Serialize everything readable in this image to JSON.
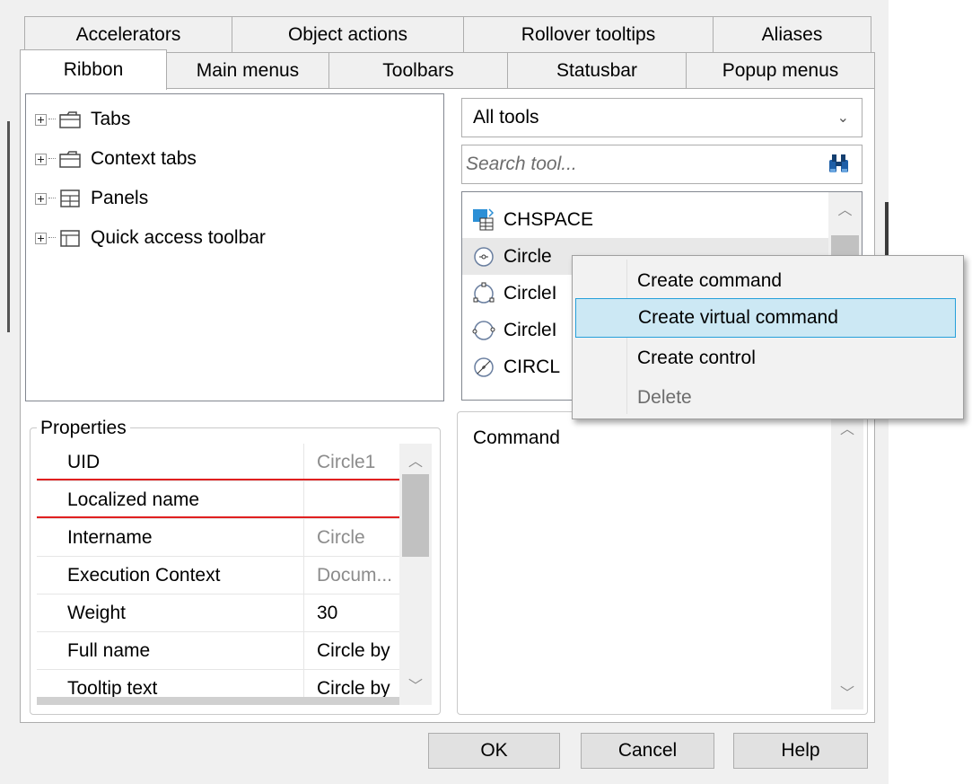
{
  "tabs_row1": [
    "Accelerators",
    "Object actions",
    "Rollover tooltips",
    "Aliases"
  ],
  "tabs_row2": [
    "Ribbon",
    "Main menus",
    "Toolbars",
    "Statusbar",
    "Popup menus"
  ],
  "selected_tab": "Ribbon",
  "tree": {
    "items": [
      {
        "label": "Tabs",
        "icon": "tabs-folder-icon"
      },
      {
        "label": "Context tabs",
        "icon": "context-tabs-folder-icon"
      },
      {
        "label": "Panels",
        "icon": "panels-icon"
      },
      {
        "label": "Quick access toolbar",
        "icon": "quick-access-toolbar-icon"
      }
    ]
  },
  "filter": {
    "selected": "All tools"
  },
  "search": {
    "placeholder": "Search tool...",
    "icon": "binoculars-icon"
  },
  "tools": {
    "items": [
      {
        "label": "CHSPACE",
        "icon": "chspace-icon"
      },
      {
        "label": "Circle",
        "icon": "circle-icon"
      },
      {
        "label": "CircleI",
        "icon": "circle-3point-icon"
      },
      {
        "label": "CircleI",
        "icon": "circle-2point-icon"
      },
      {
        "label": "CIRCL",
        "icon": "circle-diameter-icon"
      }
    ]
  },
  "context_menu": {
    "items": [
      {
        "label": "Create command",
        "state": "normal"
      },
      {
        "label": "Create virtual command",
        "state": "highlighted"
      },
      {
        "label": "Create control",
        "state": "normal"
      },
      {
        "label": "Delete",
        "state": "disabled"
      }
    ]
  },
  "properties": {
    "title": "Properties",
    "rows": [
      {
        "key": "UID",
        "value": "Circle1"
      },
      {
        "key": "Localized name",
        "value": ""
      },
      {
        "key": "Intername",
        "value": "Circle"
      },
      {
        "key": "Execution Context",
        "value": "Docum..."
      },
      {
        "key": "Weight",
        "value": "30"
      },
      {
        "key": "Full name",
        "value": "Circle by"
      },
      {
        "key": "Tooltip text",
        "value": "Circle by"
      }
    ]
  },
  "detail": {
    "label": "Command"
  },
  "buttons": {
    "ok": "OK",
    "cancel": "Cancel",
    "help": "Help"
  },
  "colors": {
    "menu_highlight": "#cce8f4",
    "menu_highlight_border": "#26a0da",
    "error_underline": "#e02020",
    "binoculars": "#1e5fa8"
  }
}
